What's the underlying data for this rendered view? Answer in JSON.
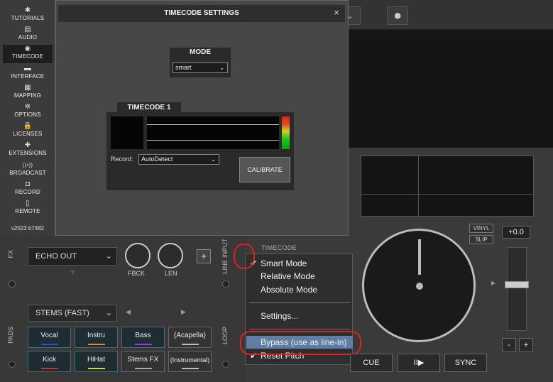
{
  "sidebar": {
    "items": [
      {
        "label": "TUTORIALS",
        "icon": "✱"
      },
      {
        "label": "AUDIO",
        "icon": "▤"
      },
      {
        "label": "TIMECODE",
        "icon": "◉"
      },
      {
        "label": "INTERFACE",
        "icon": "▬"
      },
      {
        "label": "MAPPING",
        "icon": "▦"
      },
      {
        "label": "OPTIONS",
        "icon": "✲"
      },
      {
        "label": "LICENSES",
        "icon": "🔒"
      },
      {
        "label": "EXTENSIONS",
        "icon": "✚"
      },
      {
        "label": "BROADCAST",
        "icon": "((•))"
      },
      {
        "label": "RECORD",
        "icon": "◘"
      },
      {
        "label": "REMOTE",
        "icon": "▯"
      }
    ],
    "active": "TIMECODE",
    "version": "v2023 b7482"
  },
  "dialog": {
    "title": "TIMECODE SETTINGS",
    "close": "×",
    "mode_title": "MODE",
    "mode_value": "smart",
    "tc_title": "TIMECODE 1",
    "record_label": "Record:",
    "record_value": "AutoDetect",
    "calibrate": "CALIBRATE"
  },
  "left_deck": {
    "fx_label": "FX",
    "fx_effect": "ECHO OUT",
    "knob1": "FBCK",
    "knob2": "LEN",
    "plus": "+",
    "line_input": "LINE INPUT",
    "pads_label": "PADS",
    "loop_label": "LOOP",
    "stems_select": "STEMS (FAST)",
    "pads": [
      {
        "label": "Vocal",
        "color": "#2b4fd8"
      },
      {
        "label": "Instru",
        "color": "#e08a1e"
      },
      {
        "label": "Bass",
        "color": "#9b3fd0"
      },
      {
        "label": "(Acapella)",
        "color": "#bbbbbb"
      },
      {
        "label": "Kick",
        "color": "#d42b2b"
      },
      {
        "label": "HiHat",
        "color": "#d8d22b"
      },
      {
        "label": "Stems FX",
        "color": "#aaaaaa"
      },
      {
        "label": "(Instrumental)",
        "color": "#bbbbbb"
      }
    ]
  },
  "menu": {
    "header": "TIMECODE",
    "items": [
      {
        "label": "Smart Mode",
        "checked": true
      },
      {
        "label": "Relative Mode",
        "checked": false
      },
      {
        "label": "Absolute Mode",
        "checked": false
      },
      {
        "label": "Settings...",
        "checked": false
      },
      {
        "label": "Bypass (use as line-in)",
        "checked": false,
        "highlighted": true
      },
      {
        "label": "Reset Pitch",
        "checked": true
      }
    ]
  },
  "right_deck": {
    "vinyl": "VINYL",
    "slip": "SLIP",
    "pitch": "+0.0",
    "minus": "-",
    "plus": "+",
    "cue": "CUE",
    "play": "II▶",
    "sync": "SYNC"
  },
  "colors": {
    "highlight": "#5f7da5",
    "annotation": "#e02020"
  }
}
